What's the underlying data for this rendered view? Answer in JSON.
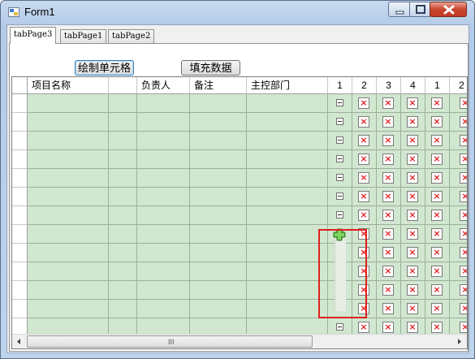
{
  "window": {
    "title": "Form1"
  },
  "tabs": [
    {
      "label": "tabPage3",
      "active": true
    },
    {
      "label": "tabPage1",
      "active": false
    },
    {
      "label": "tabPage2",
      "active": false
    }
  ],
  "buttons": {
    "draw_cells": "绘制单元格",
    "fill_data": "填充数据"
  },
  "grid": {
    "columns": [
      "项目名称",
      "",
      "负责人",
      "备注",
      "主控部门",
      "1",
      "2",
      "3",
      "4",
      "1",
      "2"
    ],
    "row_count": 13,
    "cell_color": "#d1e7d0",
    "expand_icon": "minus-box-icon",
    "checkbox_icon": "red-x-icon",
    "drag_icon": "green-plus-icon"
  },
  "scrollbar": {
    "grip": "III"
  },
  "colors": {
    "highlight": "#e01e1e",
    "close_button": "#c9442d",
    "title_bar": "#c8daef"
  }
}
